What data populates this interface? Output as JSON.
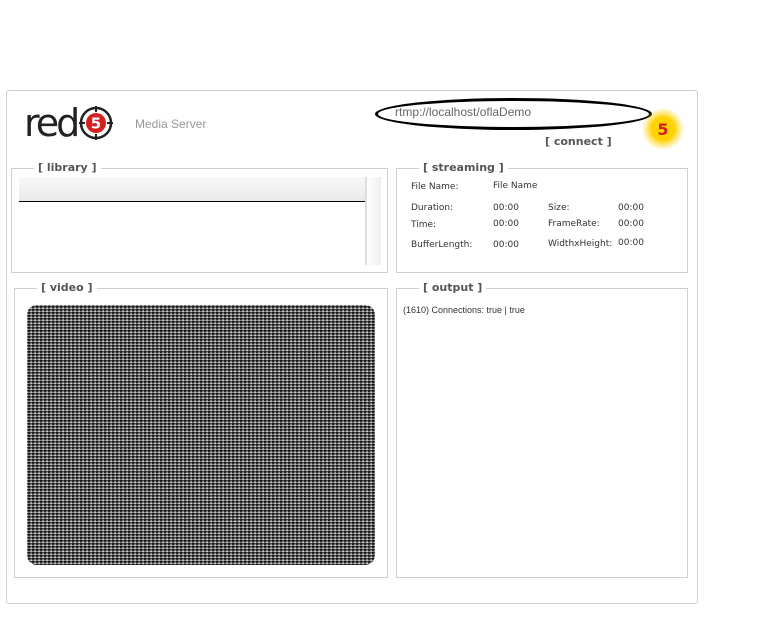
{
  "header": {
    "logo_text": "red",
    "logo_badge": "5",
    "subtitle": "Media Server",
    "url_value": "rtmp://localhost/oflaDemo",
    "connect_label": "[ connect ]",
    "status_indicator": "5",
    "status_color": "#ffd200"
  },
  "library": {
    "title": "[ library ]"
  },
  "streaming": {
    "title": "[ streaming ]",
    "file_name_label": "File Name:",
    "file_name_value": "File Name",
    "duration_label": "Duration:",
    "duration_value": "00:00",
    "size_label": "Size:",
    "size_value": "00:00",
    "time_label": "Time:",
    "time_value": "00:00",
    "framerate_label": "FrameRate:",
    "framerate_value": "00:00",
    "bufferlength_label": "BufferLength:",
    "bufferlength_value": "00:00",
    "wxh_label": "WidthxHeight:",
    "wxh_value": "00:00"
  },
  "video": {
    "title": "[ video ]"
  },
  "output": {
    "title": "[ output ]",
    "log": "(1610) Connections: true | true"
  },
  "colors": {
    "brand_red": "#d61f1f",
    "border": "#cfcfcf"
  }
}
